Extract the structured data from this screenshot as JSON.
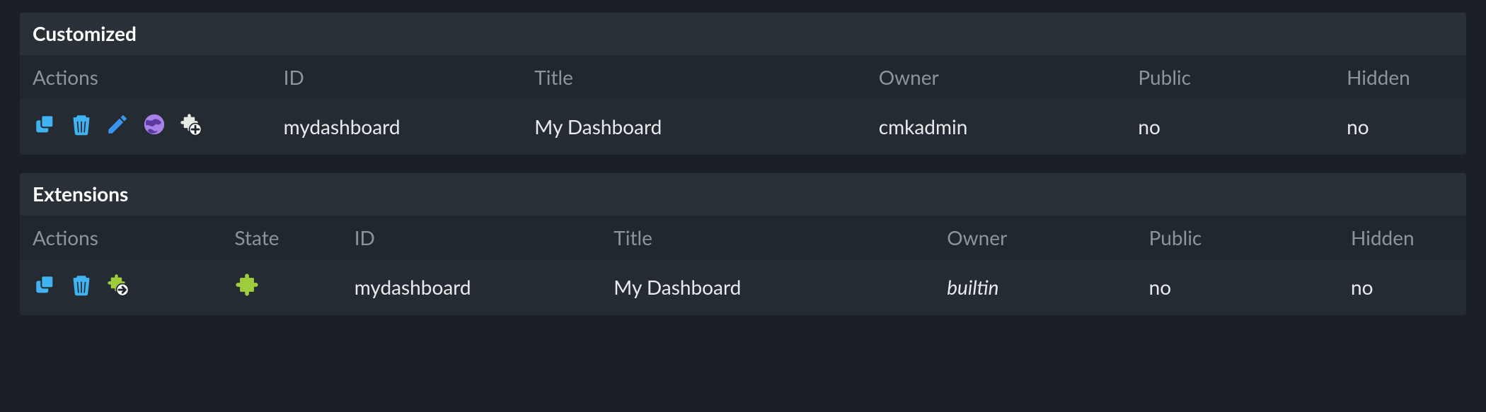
{
  "colors": {
    "blue": "#41b3f2",
    "edit": "#3a94f0",
    "purple": "#a980e8",
    "green": "#9ecc3d",
    "offwhite": "#e6ebe4",
    "dark_slot": "#434a52"
  },
  "sections": [
    {
      "title": "Customized",
      "columns": [
        {
          "key": "actions",
          "label": "Actions"
        },
        {
          "key": "id",
          "label": "ID"
        },
        {
          "key": "title",
          "label": "Title"
        },
        {
          "key": "owner",
          "label": "Owner"
        },
        {
          "key": "public",
          "label": "Public"
        },
        {
          "key": "hidden",
          "label": "Hidden"
        }
      ],
      "rows": [
        {
          "id": "mydashboard",
          "title": "My Dashboard",
          "owner": "cmkadmin",
          "public": "no",
          "hidden": "no"
        }
      ]
    },
    {
      "title": "Extensions",
      "columns": [
        {
          "key": "actions",
          "label": "Actions"
        },
        {
          "key": "state",
          "label": "State"
        },
        {
          "key": "id",
          "label": "ID"
        },
        {
          "key": "title",
          "label": "Title"
        },
        {
          "key": "owner",
          "label": "Owner"
        },
        {
          "key": "public",
          "label": "Public"
        },
        {
          "key": "hidden",
          "label": "Hidden"
        }
      ],
      "rows": [
        {
          "id": "mydashboard",
          "title": "My Dashboard",
          "owner": "builtin",
          "owner_italic": true,
          "public": "no",
          "hidden": "no"
        }
      ]
    }
  ]
}
